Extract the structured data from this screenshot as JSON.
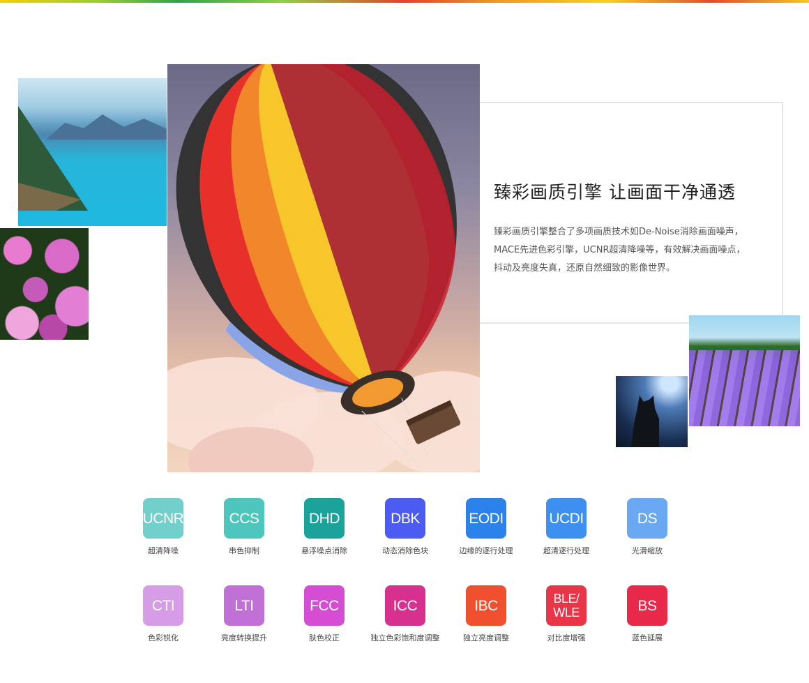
{
  "panel": {
    "title": "臻彩画质引擎 让画面干净通透",
    "desc_lines": [
      "臻彩画质引擎整合了多项画质技术如De-Noise消除画面噪声，",
      "MACE先进色彩引擎，UCNR超清降噪等，有效解决画面噪点，",
      "抖动及亮度失真，还原自然细致的影像世界。"
    ]
  },
  "features": [
    {
      "code": "UCNR",
      "label": "超清降噪",
      "color": "#72cfcc"
    },
    {
      "code": "CCS",
      "label": "串色抑制",
      "color": "#4dc7bd"
    },
    {
      "code": "DHD",
      "label": "悬浮噪点消除",
      "color": "#1aa39a"
    },
    {
      "code": "DBK",
      "label": "动态消除色块",
      "color": "#4c5cf0"
    },
    {
      "code": "EODI",
      "label": "边缘的逐行处理",
      "color": "#2c82ec"
    },
    {
      "code": "UCDI",
      "label": "超清逐行处理",
      "color": "#3d8ff0"
    },
    {
      "code": "DS",
      "label": "光滑缩放",
      "color": "#6aa8f2"
    },
    {
      "code": "CTI",
      "label": "色彩锐化",
      "color": "#d79ce6"
    },
    {
      "code": "LTI",
      "label": "亮度转换提升",
      "color": "#c170d6"
    },
    {
      "code": "FCC",
      "label": "肤色校正",
      "color": "#d54dd2"
    },
    {
      "code": "ICC",
      "label": "独立色彩饱和度调整",
      "color": "#d8308e"
    },
    {
      "code": "IBC",
      "label": "独立亮度调整",
      "color": "#f0502e"
    },
    {
      "code": "BLE/\nWLE",
      "label": "对比度增强",
      "color": "#e83548"
    },
    {
      "code": "BS",
      "label": "蓝色延展",
      "color": "#e9294a"
    }
  ]
}
